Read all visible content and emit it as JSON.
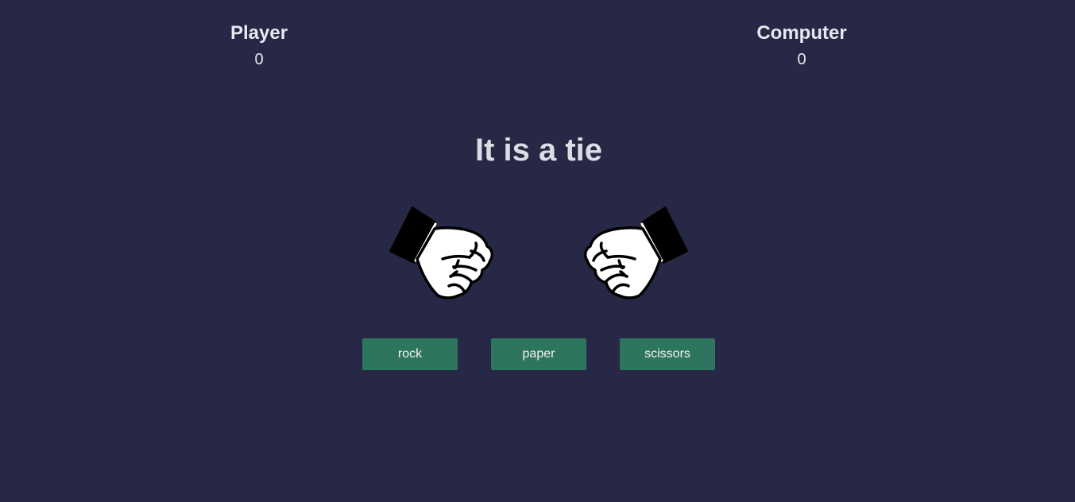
{
  "scoreboard": {
    "player": {
      "label": "Player",
      "score": "0"
    },
    "computer": {
      "label": "Computer",
      "score": "0"
    }
  },
  "result": {
    "message": "It is a tie"
  },
  "hands": {
    "player": {
      "choice": "rock",
      "icon": "rock-fist-icon"
    },
    "computer": {
      "choice": "rock",
      "icon": "rock-fist-icon"
    }
  },
  "choices": {
    "rock": "rock",
    "paper": "paper",
    "scissors": "scissors"
  },
  "colors": {
    "background": "#272845",
    "button": "#2e7560",
    "text": "#e6e6ef"
  }
}
